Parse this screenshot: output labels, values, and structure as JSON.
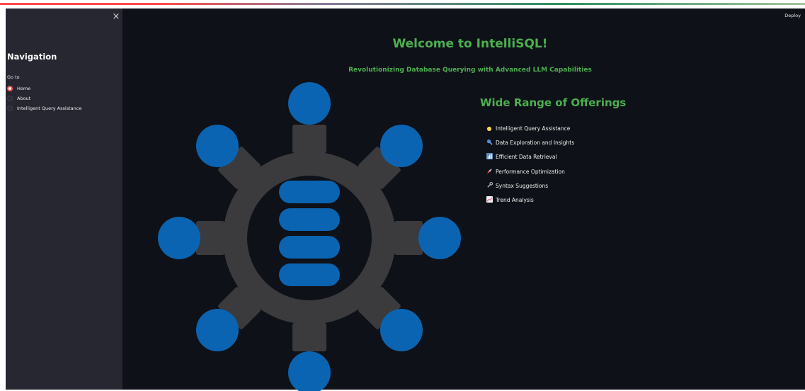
{
  "sidebar": {
    "title": "Navigation",
    "goto_label": "Go to",
    "close_symbol": "×",
    "options": [
      {
        "label": "Home",
        "selected": true
      },
      {
        "label": "About",
        "selected": false
      },
      {
        "label": "Intelligent Query Assistance",
        "selected": false
      }
    ]
  },
  "header": {
    "deploy_label": "Deploy"
  },
  "main": {
    "title": "Welcome to IntelliSQL!",
    "subtitle": "Revolutionizing Database Querying with Advanced LLM Capabilities",
    "offerings_title": "Wide Range of Offerings",
    "offerings": [
      {
        "icon": "lightbulb-icon",
        "label": "Intelligent Query Assistance"
      },
      {
        "icon": "magnifier-icon",
        "label": "Data Exploration and Insights"
      },
      {
        "icon": "data-icon",
        "label": "Efficient Data Retrieval"
      },
      {
        "icon": "rocket-icon",
        "label": "Performance Optimization"
      },
      {
        "icon": "wrench-icon",
        "label": "Syntax Suggestions"
      },
      {
        "icon": "chart-icon",
        "label": "Trend Analysis"
      }
    ]
  },
  "colors": {
    "accent_green": "#4caf50",
    "graphic_blue": "#0b64b1",
    "gear_gray": "#3b3b3d",
    "radio_red": "#ff4b4b",
    "sidebar_bg": "#262730",
    "main_bg": "#0e1117"
  }
}
